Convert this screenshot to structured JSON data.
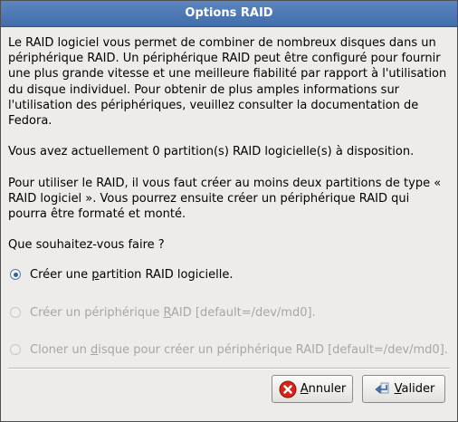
{
  "window": {
    "title": "Options RAID"
  },
  "main": {
    "paragraph1": "Le RAID logiciel vous permet de combiner de nombreux disques dans un périphérique RAID. Un périphérique RAID peut être configuré pour fournir une plus grande vitesse et une meilleure fiabilité par rapport à l'utilisation du disque individuel. Pour obtenir de plus amples informations sur l'utilisation des périphériques, veuillez consulter la documentation de Fedora.",
    "paragraph2": "Vous avez actuellement 0 partition(s) RAID logicielle(s) à disposition.",
    "paragraph3": "Pour utiliser le RAID, il vous faut créer au moins deux partitions de type « RAID logiciel ». Vous pourrez ensuite créer un périphérique RAID qui pourra être formaté et monté.",
    "question": "Que souhaitez-vous faire ?"
  },
  "options": [
    {
      "before": "Créer une ",
      "mnemonic": "p",
      "after": "artition RAID logicielle.",
      "checked": true,
      "enabled": true
    },
    {
      "before": "Créer un périphérique ",
      "mnemonic": "R",
      "after": "AID [default=/dev/md0].",
      "checked": false,
      "enabled": false
    },
    {
      "before": "Cloner un ",
      "mnemonic": "d",
      "after": "isque pour créer un périphérique RAID [default=/dev/md0].",
      "checked": false,
      "enabled": false
    }
  ],
  "buttons": {
    "cancel": {
      "before": "",
      "mnemonic": "A",
      "after": "nnuler",
      "icon": "cancel-icon"
    },
    "ok": {
      "before": "",
      "mnemonic": "V",
      "after": "alider",
      "icon": "ok-icon"
    }
  },
  "colors": {
    "titlebar": "#4a76b2",
    "dialog_background": "#edeceb",
    "disabled_text": "#a8a6a3",
    "cancel_icon": "#d8231b"
  }
}
